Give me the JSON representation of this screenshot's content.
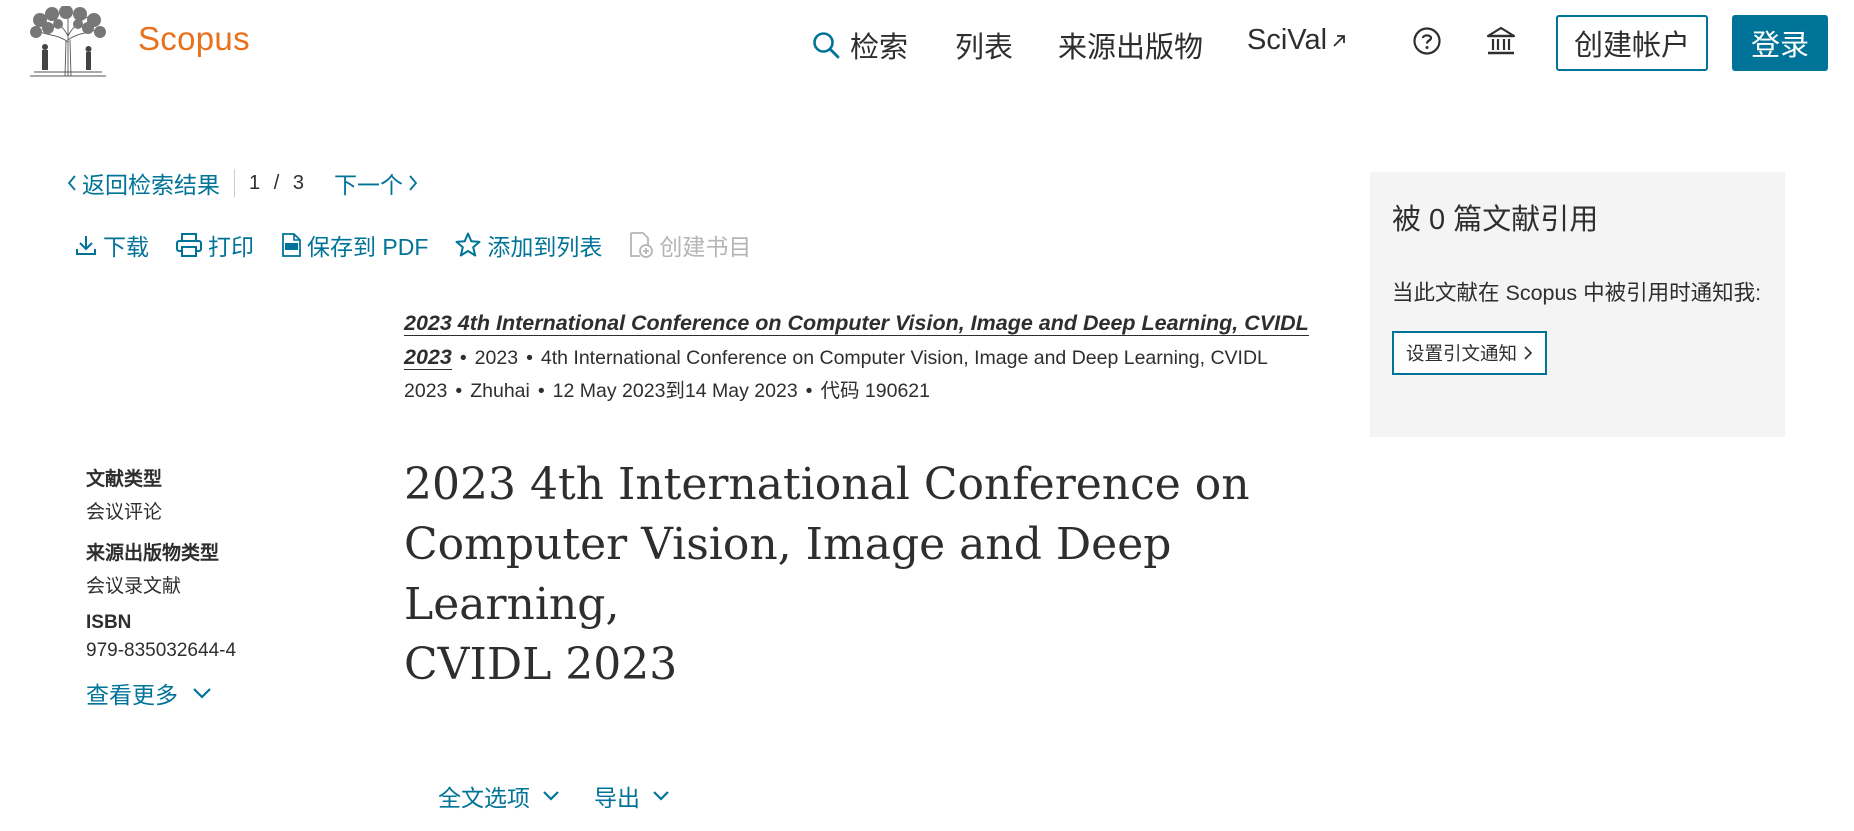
{
  "header": {
    "brand": "Scopus",
    "nav": {
      "search": "检索",
      "lists": "列表",
      "sources": "来源出版物",
      "scival": "SciVal"
    },
    "create_account": "创建帐户",
    "login": "登录"
  },
  "result_nav": {
    "back": "返回检索结果",
    "current": "1",
    "slash": "/",
    "total": "3",
    "next": "下一个"
  },
  "toolbar": {
    "download": "下载",
    "print": "打印",
    "save_pdf": "保存到 PDF",
    "add_to_list": "添加到列表",
    "create_bib": "创建书目"
  },
  "source": {
    "title": "2023 4th International Conference on Computer Vision, Image and Deep Learning, CVIDL 2023",
    "year": "2023",
    "conference": "4th International Conference on Computer Vision, Image and Deep Learning, CVIDL 2023",
    "location": "Zhuhai",
    "dates": "12 May 2023到14 May 2023",
    "code": "代码 190621",
    "separator": "•"
  },
  "meta": {
    "doc_type_label": "文献类型",
    "doc_type_value": "会议评论",
    "source_type_label": "来源出版物类型",
    "source_type_value": "会议录文献",
    "isbn_label": "ISBN",
    "isbn_value": "979-835032644-4",
    "see_more": "查看更多"
  },
  "document": {
    "title_line1": "2023 4th International Conference on",
    "title_line2": "Computer Vision, Image and Deep Learning,",
    "title_line3": "CVIDL 2023"
  },
  "options": {
    "full_text": "全文选项",
    "export": "导出"
  },
  "cited_panel": {
    "title": "被 0 篇文献引用",
    "notify_text": "当此文献在 Scopus 中被引用时通知我:",
    "button": "设置引文通知"
  },
  "colors": {
    "accent": "#007398",
    "brand": "#e9711c",
    "text": "#2e2e2e",
    "panel_bg": "#f4f4f4",
    "disabled": "#b5b5b5"
  },
  "icons": [
    "elsevier-tree-logo",
    "search-icon",
    "external-link-icon",
    "help-icon",
    "institution-icon",
    "chevron-left-icon",
    "chevron-right-icon",
    "download-icon",
    "print-icon",
    "pdf-icon",
    "star-icon",
    "bibliography-icon",
    "chevron-down-icon"
  ]
}
